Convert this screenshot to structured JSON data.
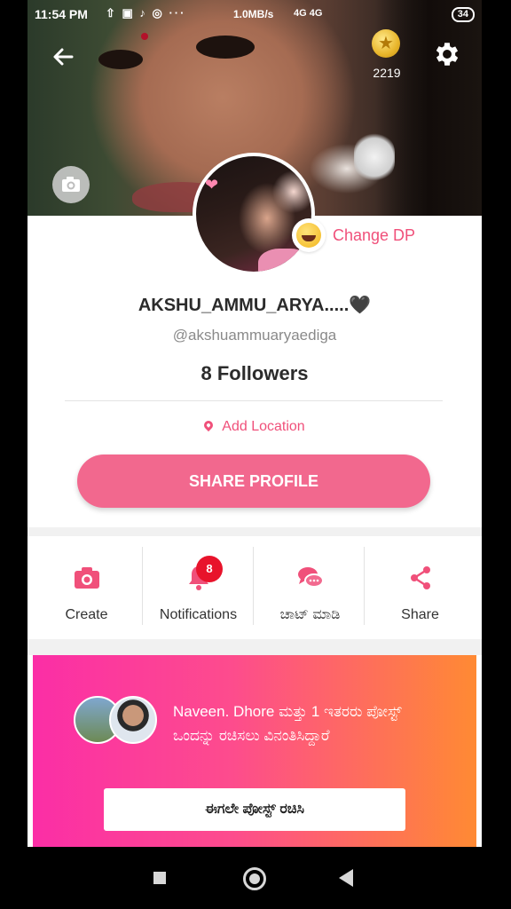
{
  "status_bar": {
    "time": "11:54 PM",
    "notification_icons": "⇧ ▣ ♪ ◎ ···",
    "network_speed": "1.0MB/s",
    "signal": "4G 4G",
    "battery": "34"
  },
  "header": {
    "coins": "2219"
  },
  "profile": {
    "display_name": "AKSHU_AMMU_ARYA.....🖤",
    "handle": "@akshuammuaryaedigan",
    "handle_visible": "@akshuammuaryaediga",
    "followers": "8 Followers",
    "add_location": "Add Location",
    "change_dp": "Change DP",
    "share_profile": "SHARE PROFILE"
  },
  "actions": [
    {
      "label": "Create",
      "icon": "camera-icon"
    },
    {
      "label": "Notifications",
      "icon": "bell-icon",
      "badge": "8"
    },
    {
      "label": "ಚಾಟ್ ಮಾಡಿ",
      "icon": "chat-icon"
    },
    {
      "label": "Share",
      "icon": "share-icon"
    }
  ],
  "promo": {
    "message": "Naveen. Dhore ಮತ್ತು 1 ಇತರರು ಪೋಸ್ಟ್ ಒಂದನ್ನು ರಚಿಸಲು ವಿನಂತಿಸಿದ್ದಾರೆ",
    "cta": "ಈಗಲೇ ಪೋಸ್ಟ್ ರಚಿಸಿ"
  },
  "colors": {
    "accent": "#f2688e",
    "accent_text": "#f0507a",
    "badge": "#e8132b",
    "promo_start": "#fb2ea6",
    "promo_end": "#ff8a33"
  }
}
